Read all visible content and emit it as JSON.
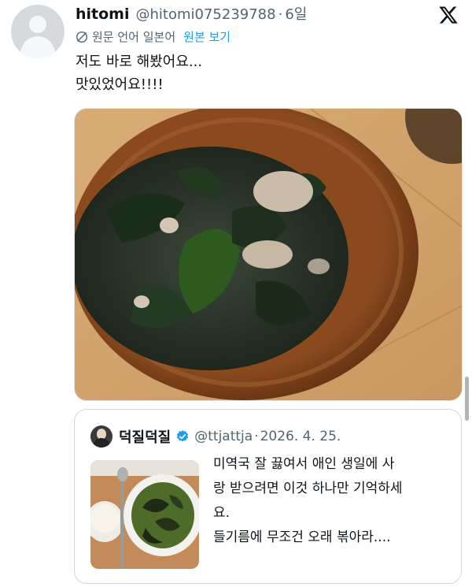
{
  "post": {
    "display_name": "hitomi",
    "handle": "@hitomi075239788",
    "separator": "·",
    "time": "6일",
    "translate": {
      "language_note": "원문 언어 일본어",
      "show_original": "원본 보기"
    },
    "text_lines": [
      "저도 바로 해봤어요...",
      "맛있었어요!!!!"
    ],
    "media_icon": "photo-soup"
  },
  "quote": {
    "display_name": "덕질덕질",
    "handle": "@ttjattja",
    "separator": "·",
    "date": "2026. 4. 25.",
    "text_lines": [
      "미역국 잘 끓여서 애인 생일에 사",
      "랑 받으려면 이것 하나만 기억하세",
      "요.",
      "들기름에 무조건 오래 볶아라...."
    ]
  },
  "colors": {
    "accent": "#1d9bf0",
    "secondary_text": "#536471",
    "border": "#cfd9de"
  },
  "icons": {
    "brand": "x-logo-icon",
    "translate": "globe-slash-icon",
    "verified": "verified-badge-icon"
  }
}
